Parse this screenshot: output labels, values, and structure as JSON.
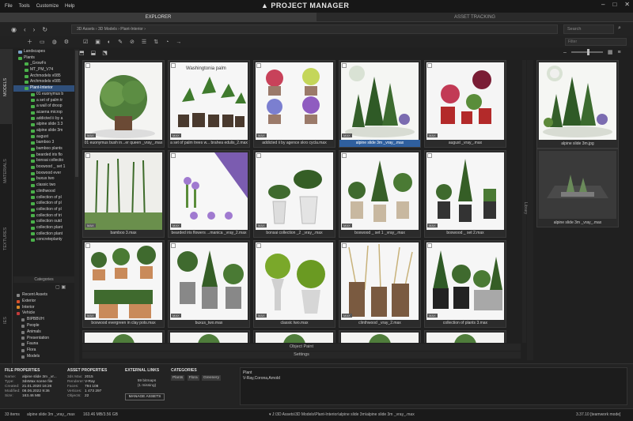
{
  "menu": [
    "File",
    "Tools",
    "Customize",
    "Help"
  ],
  "app_title": "PROJECT MANAGER",
  "tabs": {
    "explorer": "EXPLORER",
    "asset_tracking": "ASSET TRACKING"
  },
  "address": {
    "path": "3D Assets  ›  3D Models  ›  Plant-Interior  ›",
    "search_placeholder": "Search",
    "filter_placeholder": "Filter"
  },
  "side_tabs": {
    "models": "MODELS",
    "materials": "MATERIALS",
    "textures": "TEXTURES",
    "ies": "IES"
  },
  "tree": [
    "Landscapes",
    "Plants",
    "_GrowFx",
    "MT_PM_V74",
    "Archmodels v085",
    "Archmodels v085",
    "Plant-Interior",
    "01 euonymus b",
    "a set of palm tr",
    "a wall of droop",
    "acaena microp",
    "addicted ii by a",
    "alpine slide 3.3",
    "alpine slide 3m",
    "august",
    "bamboo 3",
    "bamboo plants",
    "bearded iris flo",
    "bonsai collectio",
    "boxwood _ set 1",
    "boxwood ever",
    "buxus two",
    "classic two",
    "clinthwood",
    "collection of pl",
    "collection of pl",
    "collection of pl",
    "collection of tri",
    "collection outd",
    "collection plant",
    "collection plant",
    "concreteplanty"
  ],
  "categories_header": "Categories",
  "categories": [
    {
      "label": "Recent Assets",
      "color": "#888888"
    },
    {
      "label": "Exterior",
      "color": "#d8512b"
    },
    {
      "label": "Interior",
      "color": "#d88a2b"
    },
    {
      "label": "Vehicle",
      "color": "#c23b3b"
    },
    {
      "label": "BIPBBVH",
      "color": "#7a7a7a"
    },
    {
      "label": "People",
      "color": "#7a7a7a"
    },
    {
      "label": "Animals",
      "color": "#7a7a7a"
    },
    {
      "label": "Presentation",
      "color": "#7a7a7a"
    },
    {
      "label": "Fauna",
      "color": "#7a7a7a"
    },
    {
      "label": "Flora",
      "color": "#7a7a7a"
    },
    {
      "label": "Models",
      "color": "#7a7a7a"
    }
  ],
  "assets": [
    {
      "caption": "01 euonymus bush in...er queen _vray_.max",
      "badge": "MAX"
    },
    {
      "caption": "a set of palm trees  w... brahea edulis_2.max",
      "badge": "MAX",
      "overlay_text": "Washingtonia palm"
    },
    {
      "caption": "addicted ii by agence skro cycla.max",
      "badge": "MAX"
    },
    {
      "caption": "alpine slide 3m _vray_.max",
      "badge": "MAX",
      "selected": true
    },
    {
      "caption": "august _vray_.max",
      "badge": "MAX"
    },
    {
      "caption": "bamboo 3.max",
      "badge": "MAX"
    },
    {
      "caption": "bearded iris flowers ...manica _vray_2.max",
      "badge": "MAX"
    },
    {
      "caption": "bonsai collection _2 _vray_.max",
      "badge": "MAX"
    },
    {
      "caption": "boxwood _ set 1 _vray_.max",
      "badge": "MAX"
    },
    {
      "caption": "boxwood _ set 2.max",
      "badge": "MAX"
    },
    {
      "caption": "boxwood evergreen in clay pots.max",
      "badge": "MAX"
    },
    {
      "caption": "buxus_two.max",
      "badge": "MAX"
    },
    {
      "caption": "classic two.max",
      "badge": "MAX"
    },
    {
      "caption": "clinthwood _vray_2.max",
      "badge": "MAX"
    },
    {
      "caption": "collection of plants 3.max",
      "badge": "MAX"
    }
  ],
  "object_paint": "Object Paint",
  "settings": "Settings",
  "library": "Library",
  "preview": {
    "img_caption": "alpine slide 3m.jpg",
    "model_caption": "alpine slide 3m _vray_.max"
  },
  "file_properties": {
    "title": "FILE PROPERTIES",
    "rows": [
      [
        "Name:",
        "alpine slide 3m _vr..."
      ],
      [
        "Type:",
        "3dsMax scene file"
      ],
      [
        "Created:",
        "21.01.2020 16:26"
      ],
      [
        "Modified:",
        "08.06.2022 9:36"
      ],
      [
        "Size:",
        "163.46 MB"
      ]
    ]
  },
  "asset_properties": {
    "title": "ASSET PROPERTIES",
    "rows": [
      [
        "3ds Max:",
        "2015"
      ],
      [
        "Renderer:",
        "V-Ray"
      ],
      [
        "Faces:",
        "794 108"
      ],
      [
        "Vertices:",
        "1 473 297"
      ],
      [
        "Objects:",
        "22"
      ]
    ]
  },
  "external_links": {
    "title": "EXTERNAL LINKS",
    "bitmaps": "59 bitmaps",
    "missing": "(1 missing)",
    "button": "MANAGE ASSETS"
  },
  "categories_panel": {
    "title": "CATEGORIES",
    "tags": [
      "Plants",
      "Flora",
      "Greenery"
    ]
  },
  "notes": [
    "Plant",
    "V-Ray,Corona,Arnold"
  ],
  "status": {
    "items": "33 items",
    "selected": "alpine slide 3m _vray_.max",
    "size": "163.46 MB/3.56 GB",
    "full_path": "▾ J:\\3D Assets\\3D Models\\Plant-Interior\\alpine slide 3m\\alpine slide 3m _vray_.max",
    "version": "3.37.10 [teamwork mode]"
  }
}
